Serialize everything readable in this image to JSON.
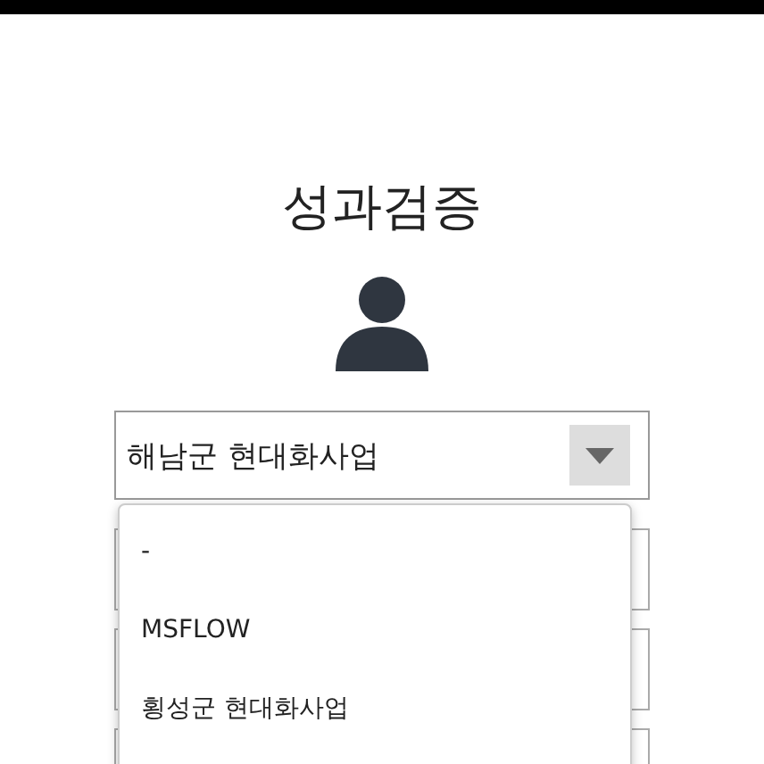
{
  "title": "성과검증",
  "select": {
    "value": "해남군 현대화사업",
    "expanded": true
  },
  "dropdown": {
    "options": [
      {
        "label": "-",
        "selected": false
      },
      {
        "label": "MSFLOW",
        "selected": false
      },
      {
        "label": "횡성군 현대화사업",
        "selected": false
      }
    ]
  }
}
